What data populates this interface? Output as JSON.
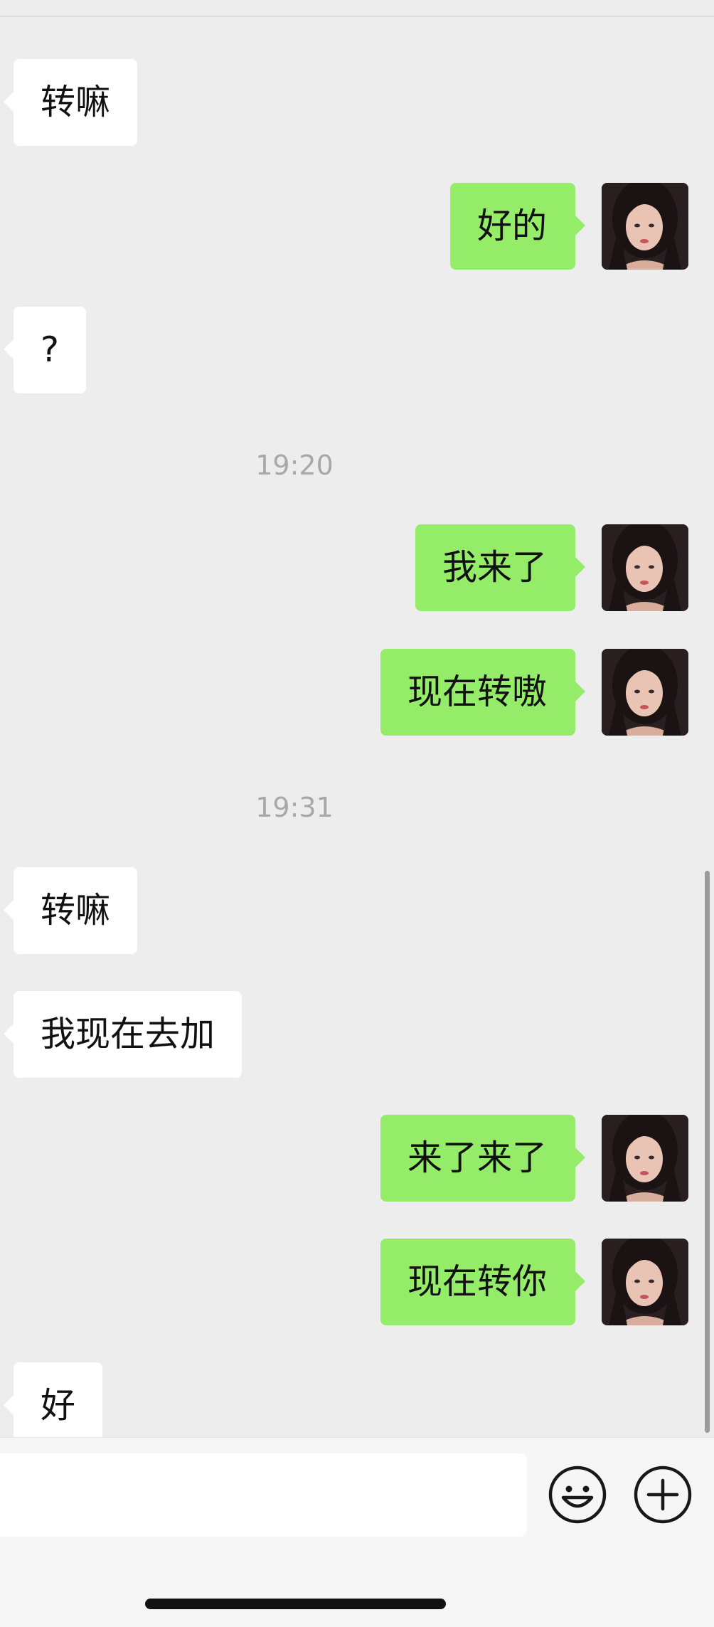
{
  "messages": [
    {
      "side": "in",
      "text": "转嘛"
    },
    {
      "side": "out",
      "text": "好的"
    },
    {
      "side": "in",
      "text": "?"
    },
    {
      "side": "time",
      "text": "19:20"
    },
    {
      "side": "out",
      "text": "我来了"
    },
    {
      "side": "out",
      "text": "现在转嗷"
    },
    {
      "side": "time",
      "text": "19:31"
    },
    {
      "side": "in",
      "text": "转嘛"
    },
    {
      "side": "in",
      "text": "我现在去加"
    },
    {
      "side": "out",
      "text": "来了来了"
    },
    {
      "side": "out",
      "text": "现在转你"
    },
    {
      "side": "in",
      "text": "好"
    }
  ],
  "input": {
    "value": "",
    "placeholder": ""
  },
  "icons": {
    "emoji": "smiley-face-icon",
    "plus": "plus-circle-icon",
    "avatar": "user-avatar-photo"
  },
  "colors": {
    "background": "#ededed",
    "incoming_bubble": "#ffffff",
    "outgoing_bubble": "#95ec69",
    "timestamp": "#a8a8a8",
    "input_bar": "#f6f6f6"
  }
}
